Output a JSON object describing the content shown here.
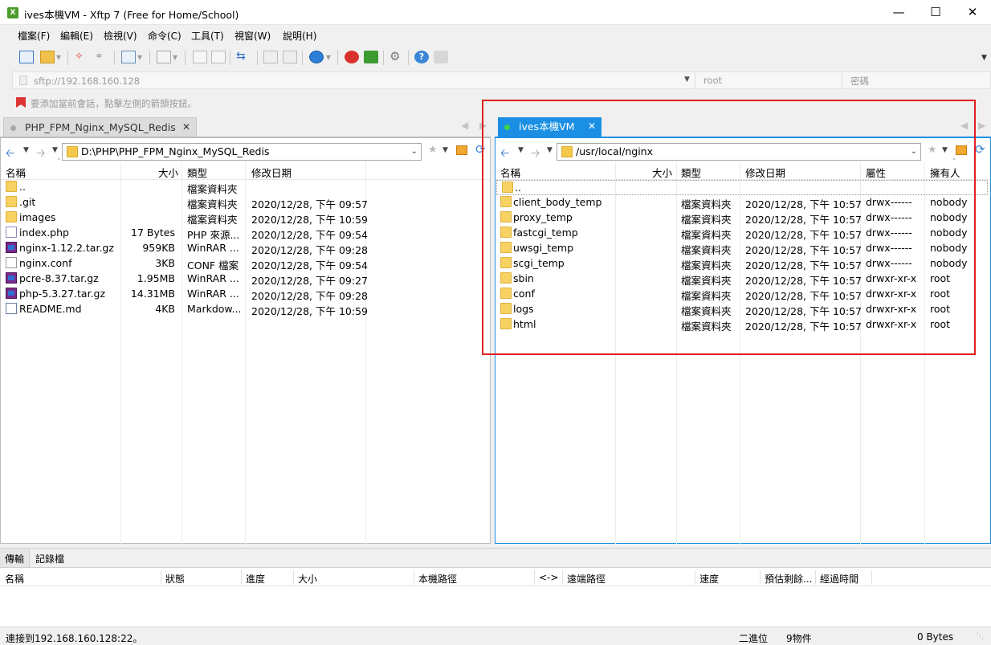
{
  "window": {
    "title": "ives本機VM - Xftp 7 (Free for Home/School)"
  },
  "menu": [
    "檔案(F)",
    "編輯(E)",
    "檢視(V)",
    "命令(C)",
    "工具(T)",
    "視窗(W)",
    "說明(H)"
  ],
  "address_bar": {
    "address": "sftp://192.168.160.128",
    "user_placeholder": "root",
    "password_placeholder": "密碼"
  },
  "hint": "要添加當前會話，點擊左側的箭頭按鈕。",
  "tabs": {
    "left": "PHP_FPM_Nginx_MySQL_Redis",
    "right": "ives本機VM"
  },
  "left_pane": {
    "path": "D:\\PHP\\PHP_FPM_Nginx_MySQL_Redis",
    "columns": [
      "名稱",
      "大小",
      "類型",
      "修改日期"
    ],
    "rows": [
      {
        "name": "..",
        "size": "",
        "type": "檔案資料夾",
        "date": "",
        "icon": "folder-icon"
      },
      {
        "name": ".git",
        "size": "",
        "type": "檔案資料夾",
        "date": "2020/12/28, 下午 09:57",
        "icon": "folder-icon"
      },
      {
        "name": "images",
        "size": "",
        "type": "檔案資料夾",
        "date": "2020/12/28, 下午 10:59",
        "icon": "folder-icon"
      },
      {
        "name": "index.php",
        "size": "17 Bytes",
        "type": "PHP 來源...",
        "date": "2020/12/28, 下午 09:54",
        "icon": "php-file-icon"
      },
      {
        "name": "nginx-1.12.2.tar.gz",
        "size": "959KB",
        "type": "WinRAR ...",
        "date": "2020/12/28, 下午 09:28",
        "icon": "winrar-archive-icon"
      },
      {
        "name": "nginx.conf",
        "size": "3KB",
        "type": "CONF 檔案",
        "date": "2020/12/28, 下午 09:54",
        "icon": "text-file-icon"
      },
      {
        "name": "pcre-8.37.tar.gz",
        "size": "1.95MB",
        "type": "WinRAR ...",
        "date": "2020/12/28, 下午 09:27",
        "icon": "winrar-archive-icon"
      },
      {
        "name": "php-5.3.27.tar.gz",
        "size": "14.31MB",
        "type": "WinRAR ...",
        "date": "2020/12/28, 下午 09:28",
        "icon": "winrar-archive-icon"
      },
      {
        "name": "README.md",
        "size": "4KB",
        "type": "Markdow...",
        "date": "2020/12/28, 下午 10:59",
        "icon": "markdown-file-icon"
      }
    ]
  },
  "right_pane": {
    "path": "/usr/local/nginx",
    "columns": [
      "名稱",
      "大小",
      "類型",
      "修改日期",
      "屬性",
      "擁有人"
    ],
    "rows": [
      {
        "name": "..",
        "size": "",
        "type": "",
        "date": "",
        "attr": "",
        "owner": ""
      },
      {
        "name": "client_body_temp",
        "size": "",
        "type": "檔案資料夾",
        "date": "2020/12/28, 下午 10:57",
        "attr": "drwx------",
        "owner": "nobody"
      },
      {
        "name": "proxy_temp",
        "size": "",
        "type": "檔案資料夾",
        "date": "2020/12/28, 下午 10:57",
        "attr": "drwx------",
        "owner": "nobody"
      },
      {
        "name": "fastcgi_temp",
        "size": "",
        "type": "檔案資料夾",
        "date": "2020/12/28, 下午 10:57",
        "attr": "drwx------",
        "owner": "nobody"
      },
      {
        "name": "uwsgi_temp",
        "size": "",
        "type": "檔案資料夾",
        "date": "2020/12/28, 下午 10:57",
        "attr": "drwx------",
        "owner": "nobody"
      },
      {
        "name": "scgi_temp",
        "size": "",
        "type": "檔案資料夾",
        "date": "2020/12/28, 下午 10:57",
        "attr": "drwx------",
        "owner": "nobody"
      },
      {
        "name": "sbin",
        "size": "",
        "type": "檔案資料夾",
        "date": "2020/12/28, 下午 10:57",
        "attr": "drwxr-xr-x",
        "owner": "root"
      },
      {
        "name": "conf",
        "size": "",
        "type": "檔案資料夾",
        "date": "2020/12/28, 下午 10:57",
        "attr": "drwxr-xr-x",
        "owner": "root"
      },
      {
        "name": "logs",
        "size": "",
        "type": "檔案資料夾",
        "date": "2020/12/28, 下午 10:57",
        "attr": "drwxr-xr-x",
        "owner": "root"
      },
      {
        "name": "html",
        "size": "",
        "type": "檔案資料夾",
        "date": "2020/12/28, 下午 10:57",
        "attr": "drwxr-xr-x",
        "owner": "root"
      }
    ]
  },
  "transfer": {
    "tabs": [
      "傳輸",
      "記錄檔"
    ],
    "columns": [
      "名稱",
      "狀態",
      "進度",
      "大小",
      "本機路徑",
      "<->",
      "遠端路徑",
      "速度",
      "預估剩餘...",
      "經過時間"
    ]
  },
  "status": {
    "connection": "連接到192.168.160.128:22。",
    "mode": "二進位",
    "count": "9物件",
    "size": "0 Bytes"
  },
  "colors": {
    "accent": "#1a8fe3",
    "highlight": "#e02020"
  }
}
